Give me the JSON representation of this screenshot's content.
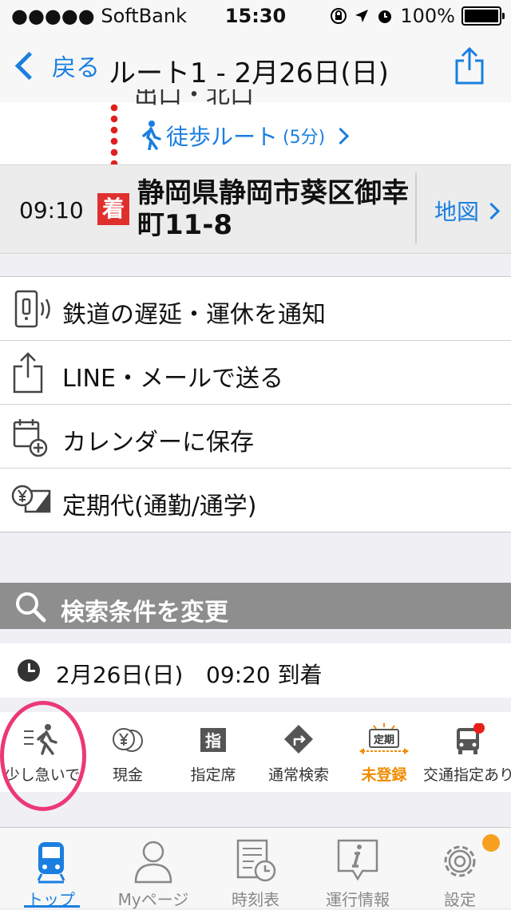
{
  "status_bar": {
    "carrier": "●●●●● SoftBank",
    "time": "15:30",
    "battery": "100%"
  },
  "nav": {
    "back_label": "戻る",
    "title": "ルート1 - 2月26日(日)"
  },
  "route": {
    "exit_partial": "出口・北口",
    "walk_label": "徒歩ルート",
    "walk_minutes": "(5分)",
    "arrival_time": "09:10",
    "arrival_badge": "着",
    "destination": "静岡県静岡市葵区御幸町11-8",
    "map_label": "地図"
  },
  "actions": [
    {
      "label": "鉄道の遅延・運休を通知",
      "icon": "phone-notify-icon"
    },
    {
      "label": "LINE・メールで送る",
      "icon": "share-icon"
    },
    {
      "label": "カレンダーに保存",
      "icon": "calendar-add-icon"
    },
    {
      "label": "定期代(通勤/通学)",
      "icon": "yen-pass-icon"
    }
  ],
  "search": {
    "header": "検索条件を変更",
    "date": "2月26日(日)",
    "time_condition": "09:20 到着"
  },
  "options": [
    {
      "label": "少し急いで",
      "icon": "walking-fast-icon"
    },
    {
      "label": "現金",
      "icon": "yen-coin-icon"
    },
    {
      "label": "指定席",
      "icon": "reserved-seat-icon",
      "icon_text": "指"
    },
    {
      "label": "通常検索",
      "icon": "route-sign-icon"
    },
    {
      "label": "未登録",
      "icon": "commuter-pass-icon",
      "icon_text": "定期",
      "color": "#f08c00"
    },
    {
      "label": "交通指定あり",
      "icon": "bus-icon"
    }
  ],
  "tabs": [
    {
      "label": "トップ",
      "icon": "train-icon",
      "active": true
    },
    {
      "label": "Myページ",
      "icon": "person-icon"
    },
    {
      "label": "時刻表",
      "icon": "timetable-icon"
    },
    {
      "label": "運行情報",
      "icon": "info-icon"
    },
    {
      "label": "設定",
      "icon": "gear-icon"
    }
  ],
  "colors": {
    "accent": "#1a7fe0",
    "arrival_badge": "#e0302e",
    "highlight_circle": "#ec3778",
    "unregistered": "#f08c00"
  }
}
